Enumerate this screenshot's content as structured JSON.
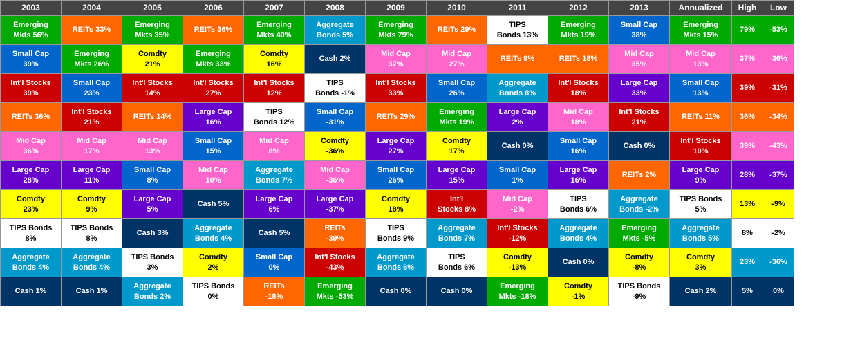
{
  "colors": {
    "emerging": "#00AA00",
    "reits": "#FF6600",
    "smallcap": "#0066CC",
    "intlstocks": "#CC0000",
    "midcap": "#FF66CC",
    "largecap": "#6600CC",
    "comdty": "#FFFF00",
    "tipsbonds": "#FFFFFF",
    "aggbonds": "#0099CC",
    "cash": "#003366",
    "header": "#555555",
    "annualized_emerging": "#00AA00",
    "annualized_midcap": "#FF66CC",
    "annualized_intlstocks": "#CC0000",
    "annualized_reits": "#FF6600",
    "annualized_largecap": "#6600CC",
    "annualized_tipsbonds": "#FFFFFF",
    "annualized_aggbonds": "#0099CC",
    "annualized_comdty": "#FFFF00",
    "annualized_cash": "#003366"
  },
  "years": [
    "2003",
    "2004",
    "2005",
    "2006",
    "2007",
    "2008",
    "2009",
    "2010",
    "2011",
    "2012",
    "2013"
  ],
  "headers": {
    "annualized": "Annualized",
    "high": "High",
    "low": "Low"
  },
  "rows": [
    [
      {
        "label": "Emerging\nMkts 56%",
        "bg": "#00AA00",
        "color": "white"
      },
      {
        "label": "REITs 33%",
        "bg": "#FF6600",
        "color": "white"
      },
      {
        "label": "Emerging\nMkts 35%",
        "bg": "#00AA00",
        "color": "white"
      },
      {
        "label": "REITs 36%",
        "bg": "#FF6600",
        "color": "white"
      },
      {
        "label": "Emerging\nMkts 40%",
        "bg": "#00AA00",
        "color": "white"
      },
      {
        "label": "Aggregate\nBonds 5%",
        "bg": "#0099CC",
        "color": "white"
      },
      {
        "label": "Emerging\nMkts 79%",
        "bg": "#00AA00",
        "color": "white"
      },
      {
        "label": "REITs 29%",
        "bg": "#FF6600",
        "color": "white"
      },
      {
        "label": "TIPS\nBonds 13%",
        "bg": "#FFFFFF",
        "color": "black"
      },
      {
        "label": "Emerging\nMkts 19%",
        "bg": "#00AA00",
        "color": "white"
      },
      {
        "label": "Small Cap\n38%",
        "bg": "#0066CC",
        "color": "white"
      },
      {
        "label": "Emerging\nMkts 15%",
        "bg": "#00AA00",
        "color": "white"
      },
      {
        "label": "79%",
        "bg": "#00AA00",
        "color": "white"
      },
      {
        "label": "-53%",
        "bg": "#00AA00",
        "color": "white"
      }
    ],
    [
      {
        "label": "Small Cap\n39%",
        "bg": "#0066CC",
        "color": "white"
      },
      {
        "label": "Emerging\nMkts 26%",
        "bg": "#00AA00",
        "color": "white"
      },
      {
        "label": "Comdty\n21%",
        "bg": "#FFFF00",
        "color": "black"
      },
      {
        "label": "Emerging\nMkts 33%",
        "bg": "#00AA00",
        "color": "white"
      },
      {
        "label": "Comdty\n16%",
        "bg": "#FFFF00",
        "color": "black"
      },
      {
        "label": "Cash 2%",
        "bg": "#003366",
        "color": "white"
      },
      {
        "label": "Mid Cap\n37%",
        "bg": "#FF66CC",
        "color": "white"
      },
      {
        "label": "Mid Cap\n27%",
        "bg": "#FF66CC",
        "color": "white"
      },
      {
        "label": "REITs 9%",
        "bg": "#FF6600",
        "color": "white"
      },
      {
        "label": "REITs 18%",
        "bg": "#FF6600",
        "color": "white"
      },
      {
        "label": "Mid Cap\n35%",
        "bg": "#FF66CC",
        "color": "white"
      },
      {
        "label": "Mid Cap\n13%",
        "bg": "#FF66CC",
        "color": "white"
      },
      {
        "label": "37%",
        "bg": "#FF66CC",
        "color": "white"
      },
      {
        "label": "-36%",
        "bg": "#FF66CC",
        "color": "white"
      }
    ],
    [
      {
        "label": "Int'l Stocks\n39%",
        "bg": "#CC0000",
        "color": "white"
      },
      {
        "label": "Small Cap\n23%",
        "bg": "#0066CC",
        "color": "white"
      },
      {
        "label": "Int'l Stocks\n14%",
        "bg": "#CC0000",
        "color": "white"
      },
      {
        "label": "Int'l Stocks\n27%",
        "bg": "#CC0000",
        "color": "white"
      },
      {
        "label": "Int'l Stocks\n12%",
        "bg": "#CC0000",
        "color": "white"
      },
      {
        "label": "TIPS\nBonds -1%",
        "bg": "#FFFFFF",
        "color": "black"
      },
      {
        "label": "Int'l Stocks\n33%",
        "bg": "#CC0000",
        "color": "white"
      },
      {
        "label": "Small Cap\n26%",
        "bg": "#0066CC",
        "color": "white"
      },
      {
        "label": "Aggregate\nBonds 8%",
        "bg": "#0099CC",
        "color": "white"
      },
      {
        "label": "Int'l Stocks\n18%",
        "bg": "#CC0000",
        "color": "white"
      },
      {
        "label": "Large Cap\n33%",
        "bg": "#6600CC",
        "color": "white"
      },
      {
        "label": "Small Cap\n13%",
        "bg": "#0066CC",
        "color": "white"
      },
      {
        "label": "39%",
        "bg": "#CC0000",
        "color": "white"
      },
      {
        "label": "-31%",
        "bg": "#CC0000",
        "color": "white"
      }
    ],
    [
      {
        "label": "REITs 36%",
        "bg": "#FF6600",
        "color": "white"
      },
      {
        "label": "Int'l Stocks\n21%",
        "bg": "#CC0000",
        "color": "white"
      },
      {
        "label": "REITs 14%",
        "bg": "#FF6600",
        "color": "white"
      },
      {
        "label": "Large Cap\n16%",
        "bg": "#6600CC",
        "color": "white"
      },
      {
        "label": "TIPS\nBonds 12%",
        "bg": "#FFFFFF",
        "color": "black"
      },
      {
        "label": "Small Cap\n-31%",
        "bg": "#0066CC",
        "color": "white"
      },
      {
        "label": "REITs 29%",
        "bg": "#FF6600",
        "color": "white"
      },
      {
        "label": "Emerging\nMkts 19%",
        "bg": "#00AA00",
        "color": "white"
      },
      {
        "label": "Large Cap\n2%",
        "bg": "#6600CC",
        "color": "white"
      },
      {
        "label": "Mid Cap\n18%",
        "bg": "#FF66CC",
        "color": "white"
      },
      {
        "label": "Int'l Stocks\n21%",
        "bg": "#CC0000",
        "color": "white"
      },
      {
        "label": "REITs 11%",
        "bg": "#FF6600",
        "color": "white"
      },
      {
        "label": "36%",
        "bg": "#FF6600",
        "color": "white"
      },
      {
        "label": "-34%",
        "bg": "#FF6600",
        "color": "white"
      }
    ],
    [
      {
        "label": "Mid Cap\n36%",
        "bg": "#FF66CC",
        "color": "white"
      },
      {
        "label": "Mid Cap\n17%",
        "bg": "#FF66CC",
        "color": "white"
      },
      {
        "label": "Mid Cap\n13%",
        "bg": "#FF66CC",
        "color": "white"
      },
      {
        "label": "Small Cap\n15%",
        "bg": "#0066CC",
        "color": "white"
      },
      {
        "label": "Mid Cap\n8%",
        "bg": "#FF66CC",
        "color": "white"
      },
      {
        "label": "Comdty\n-36%",
        "bg": "#FFFF00",
        "color": "black"
      },
      {
        "label": "Large Cap\n27%",
        "bg": "#6600CC",
        "color": "white"
      },
      {
        "label": "Comdty\n17%",
        "bg": "#FFFF00",
        "color": "black"
      },
      {
        "label": "Cash 0%",
        "bg": "#003366",
        "color": "white"
      },
      {
        "label": "Small Cap\n16%",
        "bg": "#0066CC",
        "color": "white"
      },
      {
        "label": "Cash 0%",
        "bg": "#003366",
        "color": "white"
      },
      {
        "label": "Int'l Stocks\n10%",
        "bg": "#CC0000",
        "color": "white"
      },
      {
        "label": "39%",
        "bg": "#FF66CC",
        "color": "white"
      },
      {
        "label": "-43%",
        "bg": "#FF66CC",
        "color": "white"
      }
    ],
    [
      {
        "label": "Large Cap\n28%",
        "bg": "#6600CC",
        "color": "white"
      },
      {
        "label": "Large Cap\n11%",
        "bg": "#6600CC",
        "color": "white"
      },
      {
        "label": "Small Cap\n8%",
        "bg": "#0066CC",
        "color": "white"
      },
      {
        "label": "Mid Cap\n10%",
        "bg": "#FF66CC",
        "color": "white"
      },
      {
        "label": "Aggregate\nBonds 7%",
        "bg": "#0099CC",
        "color": "white"
      },
      {
        "label": "Mid Cap\n-36%",
        "bg": "#FF66CC",
        "color": "white"
      },
      {
        "label": "Small Cap\n26%",
        "bg": "#0066CC",
        "color": "white"
      },
      {
        "label": "Large Cap\n15%",
        "bg": "#6600CC",
        "color": "white"
      },
      {
        "label": "Small Cap\n1%",
        "bg": "#0066CC",
        "color": "white"
      },
      {
        "label": "Large Cap\n16%",
        "bg": "#6600CC",
        "color": "white"
      },
      {
        "label": "REITs 2%",
        "bg": "#FF6600",
        "color": "white"
      },
      {
        "label": "Large Cap\n9%",
        "bg": "#6600CC",
        "color": "white"
      },
      {
        "label": "28%",
        "bg": "#6600CC",
        "color": "white"
      },
      {
        "label": "-37%",
        "bg": "#6600CC",
        "color": "white"
      }
    ],
    [
      {
        "label": "Comdty\n23%",
        "bg": "#FFFF00",
        "color": "black"
      },
      {
        "label": "Comdty\n9%",
        "bg": "#FFFF00",
        "color": "black"
      },
      {
        "label": "Large Cap\n5%",
        "bg": "#6600CC",
        "color": "white"
      },
      {
        "label": "Cash 5%",
        "bg": "#003366",
        "color": "white"
      },
      {
        "label": "Large Cap\n6%",
        "bg": "#6600CC",
        "color": "white"
      },
      {
        "label": "Large Cap\n-37%",
        "bg": "#6600CC",
        "color": "white"
      },
      {
        "label": "Comdty\n18%",
        "bg": "#FFFF00",
        "color": "black"
      },
      {
        "label": "Int'l\nStocks 8%",
        "bg": "#CC0000",
        "color": "white"
      },
      {
        "label": "Mid Cap\n-2%",
        "bg": "#FF66CC",
        "color": "white"
      },
      {
        "label": "TIPS\nBonds 6%",
        "bg": "#FFFFFF",
        "color": "black"
      },
      {
        "label": "Aggregate\nBonds -2%",
        "bg": "#0099CC",
        "color": "white"
      },
      {
        "label": "TIPS Bonds\n5%",
        "bg": "#FFFFFF",
        "color": "black"
      },
      {
        "label": "13%",
        "bg": "#FFFF00",
        "color": "black"
      },
      {
        "label": "-9%",
        "bg": "#FFFF00",
        "color": "black"
      }
    ],
    [
      {
        "label": "TIPS Bonds\n8%",
        "bg": "#FFFFFF",
        "color": "black"
      },
      {
        "label": "TIPS Bonds\n8%",
        "bg": "#FFFFFF",
        "color": "black"
      },
      {
        "label": "Cash 3%",
        "bg": "#003366",
        "color": "white"
      },
      {
        "label": "Aggregate\nBonds 4%",
        "bg": "#0099CC",
        "color": "white"
      },
      {
        "label": "Cash 5%",
        "bg": "#003366",
        "color": "white"
      },
      {
        "label": "REITs\n-39%",
        "bg": "#FF6600",
        "color": "white"
      },
      {
        "label": "TIPS\nBonds 9%",
        "bg": "#FFFFFF",
        "color": "black"
      },
      {
        "label": "Aggregate\nBonds 7%",
        "bg": "#0099CC",
        "color": "white"
      },
      {
        "label": "Int'l Stocks\n-12%",
        "bg": "#CC0000",
        "color": "white"
      },
      {
        "label": "Aggregate\nBonds 4%",
        "bg": "#0099CC",
        "color": "white"
      },
      {
        "label": "Emerging\nMkts -5%",
        "bg": "#00AA00",
        "color": "white"
      },
      {
        "label": "Aggregate\nBonds 5%",
        "bg": "#0099CC",
        "color": "white"
      },
      {
        "label": "8%",
        "bg": "#FFFFFF",
        "color": "black"
      },
      {
        "label": "-2%",
        "bg": "#FFFFFF",
        "color": "black"
      }
    ],
    [
      {
        "label": "Aggregate\nBonds 4%",
        "bg": "#0099CC",
        "color": "white"
      },
      {
        "label": "Aggregate\nBonds 4%",
        "bg": "#0099CC",
        "color": "white"
      },
      {
        "label": "TIPS Bonds\n3%",
        "bg": "#FFFFFF",
        "color": "black"
      },
      {
        "label": "Comdty\n2%",
        "bg": "#FFFF00",
        "color": "black"
      },
      {
        "label": "Small Cap\n0%",
        "bg": "#0066CC",
        "color": "white"
      },
      {
        "label": "Int'l Stocks\n-43%",
        "bg": "#CC0000",
        "color": "white"
      },
      {
        "label": "Aggregate\nBonds 6%",
        "bg": "#0099CC",
        "color": "white"
      },
      {
        "label": "TIPS\nBonds 6%",
        "bg": "#FFFFFF",
        "color": "black"
      },
      {
        "label": "Comdty\n-13%",
        "bg": "#FFFF00",
        "color": "black"
      },
      {
        "label": "Cash 0%",
        "bg": "#003366",
        "color": "white"
      },
      {
        "label": "Comdty\n-8%",
        "bg": "#FFFF00",
        "color": "black"
      },
      {
        "label": "Comdty\n3%",
        "bg": "#FFFF00",
        "color": "black"
      },
      {
        "label": "23%",
        "bg": "#0099CC",
        "color": "white"
      },
      {
        "label": "-36%",
        "bg": "#0099CC",
        "color": "white"
      }
    ],
    [
      {
        "label": "Cash 1%",
        "bg": "#003366",
        "color": "white"
      },
      {
        "label": "Cash 1%",
        "bg": "#003366",
        "color": "white"
      },
      {
        "label": "Aggregate\nBonds 2%",
        "bg": "#0099CC",
        "color": "white"
      },
      {
        "label": "TIPS Bonds\n0%",
        "bg": "#FFFFFF",
        "color": "black"
      },
      {
        "label": "REITs\n-18%",
        "bg": "#FF6600",
        "color": "white"
      },
      {
        "label": "Emerging\nMkts -53%",
        "bg": "#00AA00",
        "color": "white"
      },
      {
        "label": "Cash 0%",
        "bg": "#003366",
        "color": "white"
      },
      {
        "label": "Cash 0%",
        "bg": "#003366",
        "color": "white"
      },
      {
        "label": "Emerging\nMkts -18%",
        "bg": "#00AA00",
        "color": "white"
      },
      {
        "label": "Comdty\n-1%",
        "bg": "#FFFF00",
        "color": "black"
      },
      {
        "label": "TIPS Bonds\n-9%",
        "bg": "#FFFFFF",
        "color": "black"
      },
      {
        "label": "Cash 2%",
        "bg": "#003366",
        "color": "white"
      },
      {
        "label": "5%",
        "bg": "#003366",
        "color": "white"
      },
      {
        "label": "0%",
        "bg": "#003366",
        "color": "white"
      }
    ]
  ]
}
